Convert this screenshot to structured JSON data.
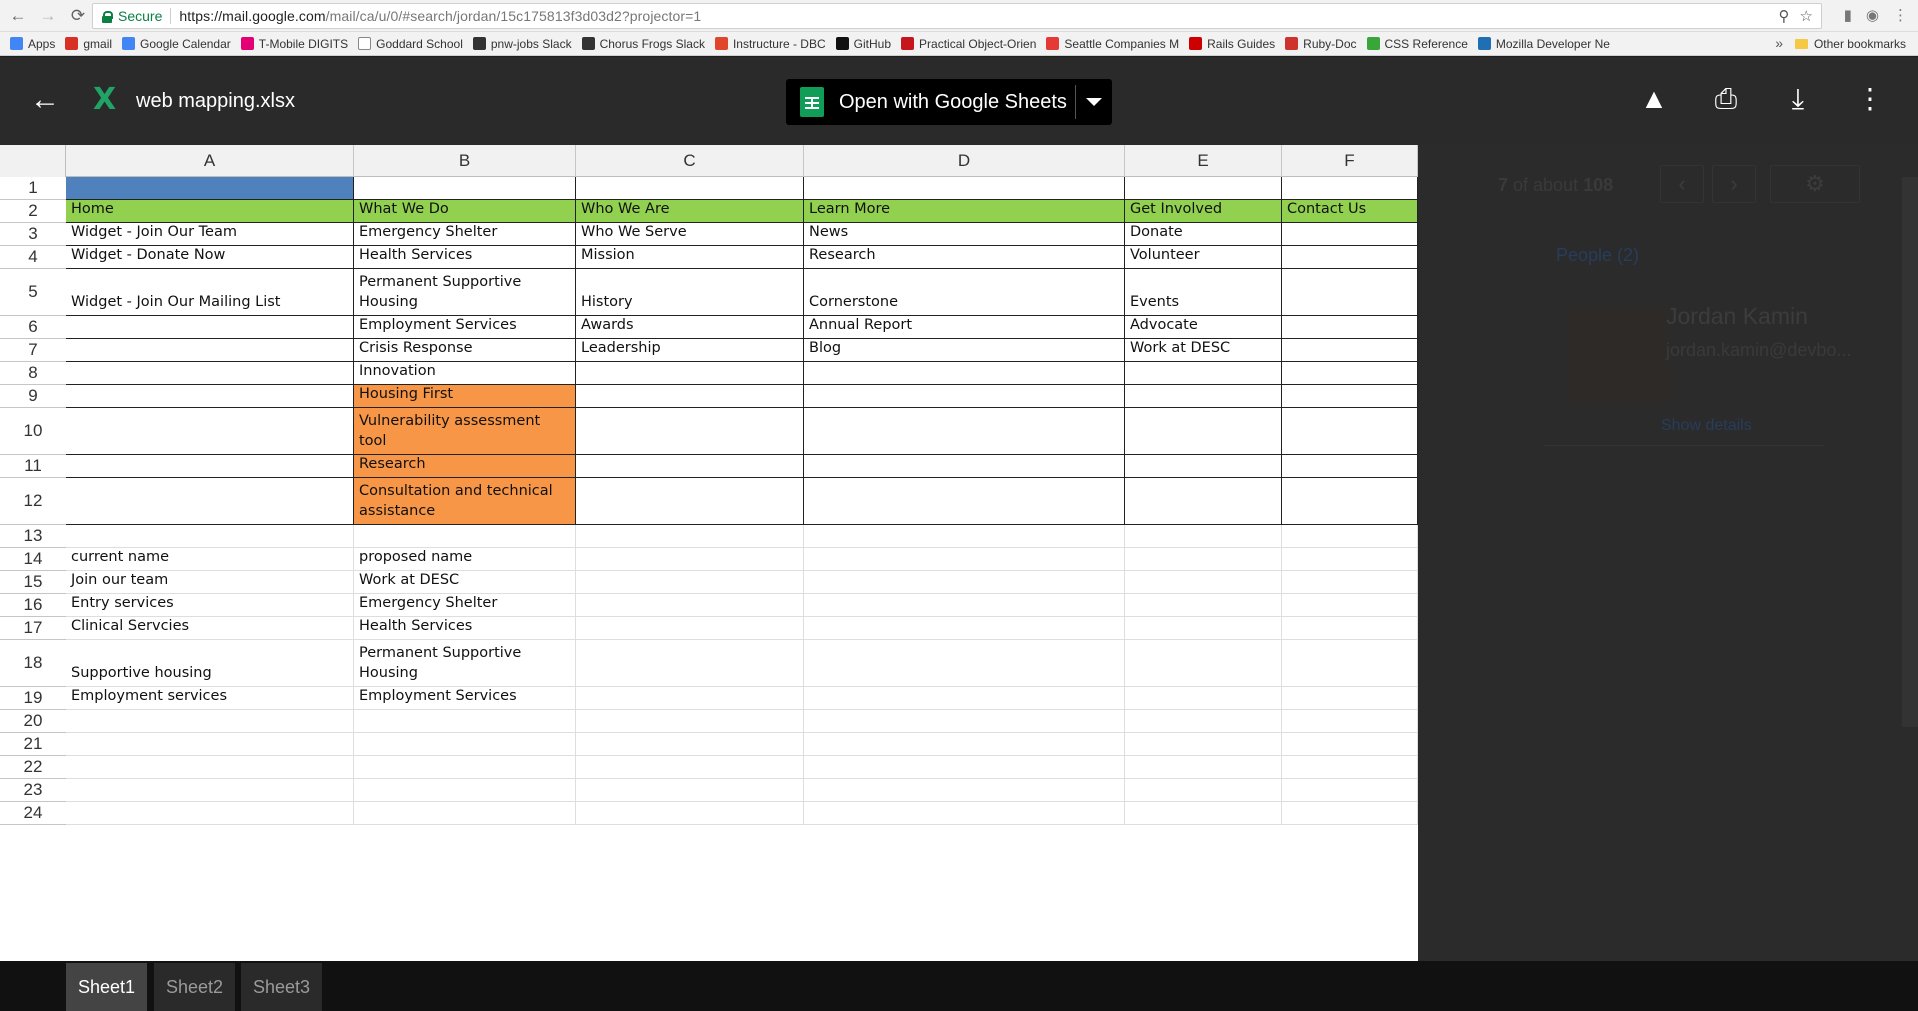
{
  "browser": {
    "secure_label": "Secure",
    "url_main": "https://mail.google.com",
    "url_rest": "/mail/ca/u/0/#search/jordan/15c175813f3d03d2?projector=1",
    "bookmarks": [
      {
        "label": "Apps",
        "icon": "apps-grid-icon",
        "color": "#4285f4"
      },
      {
        "label": "gmail",
        "icon": "gmail-icon",
        "color": "#d93025"
      },
      {
        "label": "Google Calendar",
        "icon": "calendar-icon",
        "color": "#4285f4"
      },
      {
        "label": "T-Mobile DIGITS",
        "icon": "tmobile-icon",
        "color": "#e20074"
      },
      {
        "label": "Goddard School",
        "icon": "page-icon",
        "color": "#ffffff"
      },
      {
        "label": "pnw-jobs Slack",
        "icon": "slack-icon",
        "color": "#333333"
      },
      {
        "label": "Chorus Frogs Slack",
        "icon": "slack-icon",
        "color": "#333333"
      },
      {
        "label": "Instructure - DBC",
        "icon": "instructure-icon",
        "color": "#e0462c"
      },
      {
        "label": "GitHub",
        "icon": "github-icon",
        "color": "#111111"
      },
      {
        "label": "Practical Object-Orien",
        "icon": "book-icon",
        "color": "#c4161c"
      },
      {
        "label": "Seattle Companies M",
        "icon": "map-pin-icon",
        "color": "#e53935"
      },
      {
        "label": "Rails Guides",
        "icon": "rails-icon",
        "color": "#cc0000"
      },
      {
        "label": "Ruby-Doc",
        "icon": "ruby-icon",
        "color": "#cc342d"
      },
      {
        "label": "CSS Reference",
        "icon": "css-icon",
        "color": "#3aa63a"
      },
      {
        "label": "Mozilla Developer Ne",
        "icon": "mozilla-icon",
        "color": "#1f6fb2"
      }
    ],
    "other_bookmarks": "Other bookmarks"
  },
  "viewer": {
    "file_name": "web mapping.xlsx",
    "open_with_label": "Open with Google Sheets"
  },
  "columns": [
    "A",
    "B",
    "C",
    "D",
    "E",
    "F"
  ],
  "rows": [
    {
      "num": "1",
      "cells": [
        "",
        "",
        "",
        "",
        "",
        ""
      ]
    },
    {
      "num": "2",
      "cells": [
        "Home",
        "What We Do",
        "Who We Are",
        "Learn More",
        "Get Involved",
        "Contact Us"
      ]
    },
    {
      "num": "3",
      "cells": [
        "Widget - Join Our Team",
        "Emergency Shelter",
        "Who We Serve",
        "News",
        "Donate",
        ""
      ]
    },
    {
      "num": "4",
      "cells": [
        "Widget - Donate Now",
        "Health Services",
        "Mission",
        "Research",
        "Volunteer",
        ""
      ]
    },
    {
      "num": "5",
      "cells": [
        "Widget - Join Our Mailing List",
        "Permanent Supportive Housing",
        "History",
        "Cornerstone",
        "Events",
        ""
      ]
    },
    {
      "num": "6",
      "cells": [
        "",
        "Employment Services",
        "Awards",
        "Annual Report",
        "Advocate",
        ""
      ]
    },
    {
      "num": "7",
      "cells": [
        "",
        "Crisis Response",
        "Leadership",
        "Blog",
        "Work at DESC",
        ""
      ]
    },
    {
      "num": "8",
      "cells": [
        "",
        "Innovation",
        "",
        "",
        "",
        ""
      ]
    },
    {
      "num": "9",
      "cells": [
        "",
        "Housing First",
        "",
        "",
        "",
        ""
      ]
    },
    {
      "num": "10",
      "cells": [
        "",
        "Vulnerability assessment tool",
        "",
        "",
        "",
        ""
      ]
    },
    {
      "num": "11",
      "cells": [
        "",
        "Research",
        "",
        "",
        "",
        ""
      ]
    },
    {
      "num": "12",
      "cells": [
        "",
        "Consultation and technical assistance",
        "",
        "",
        "",
        ""
      ]
    },
    {
      "num": "13",
      "cells": [
        "",
        "",
        "",
        "",
        "",
        ""
      ]
    },
    {
      "num": "14",
      "cells": [
        "current name",
        "proposed name",
        "",
        "",
        "",
        ""
      ]
    },
    {
      "num": "15",
      "cells": [
        "Join our team",
        "Work at DESC",
        "",
        "",
        "",
        ""
      ]
    },
    {
      "num": "16",
      "cells": [
        "Entry services",
        "Emergency Shelter",
        "",
        "",
        "",
        ""
      ]
    },
    {
      "num": "17",
      "cells": [
        "Clinical Servcies",
        "Health Services",
        "",
        "",
        "",
        ""
      ]
    },
    {
      "num": "18",
      "cells": [
        "Supportive housing",
        "Permanent Supportive Housing",
        "",
        "",
        "",
        ""
      ]
    },
    {
      "num": "19",
      "cells": [
        "Employment services",
        "Employment Services",
        "",
        "",
        "",
        ""
      ]
    },
    {
      "num": "20",
      "cells": [
        "",
        "",
        "",
        "",
        "",
        ""
      ]
    },
    {
      "num": "21",
      "cells": [
        "",
        "",
        "",
        "",
        "",
        ""
      ]
    },
    {
      "num": "22",
      "cells": [
        "",
        "",
        "",
        "",
        "",
        ""
      ]
    },
    {
      "num": "23",
      "cells": [
        "",
        "",
        "",
        "",
        "",
        ""
      ]
    },
    {
      "num": "24",
      "cells": [
        "",
        "",
        "",
        "",
        "",
        ""
      ]
    }
  ],
  "cell_colors": {
    "header_green": "#92d050",
    "highlight_orange": "#f79646",
    "selected_blue": "#4f81bd"
  },
  "sheets": [
    {
      "label": "Sheet1",
      "active": true
    },
    {
      "label": "Sheet2",
      "active": false
    },
    {
      "label": "Sheet3",
      "active": false
    }
  ],
  "gmail": {
    "count_prefix": "7",
    "count_mid": " of about ",
    "count_total": "108",
    "people_label": "People (2)",
    "contact_name": "Jordan Kamin",
    "contact_email": "jordan.kamin@devbo...",
    "show_details": "Show details"
  }
}
